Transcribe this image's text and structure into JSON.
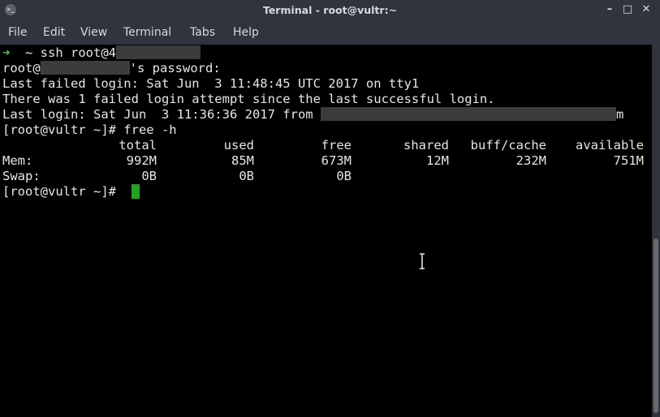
{
  "window": {
    "title": "Terminal - root@vultr:~",
    "app_icon_glyph": ">_",
    "minimize_glyph": "–",
    "maximize_glyph": "□",
    "close_glyph": "✕"
  },
  "menu": {
    "items": [
      "File",
      "Edit",
      "View",
      "Terminal",
      "Tabs",
      "Help"
    ]
  },
  "terminal": {
    "line1_arrow": "➜",
    "line1_text": "  ~ ssh root@4",
    "line2_prefix": "root@",
    "line2_suffix": "'s password:",
    "line3": "Last failed login: Sat Jun  3 11:48:45 UTC 2017 on tty1",
    "line4": "There was 1 failed login attempt since the last successful login.",
    "line5_prefix": "Last login: Sat Jun  3 11:36:36 2017 from ",
    "line5_tail": "m",
    "line6": "[root@vultr ~]# free -h",
    "free_headers": [
      "total",
      "used",
      "free",
      "shared",
      "buff/cache",
      "available"
    ],
    "free_rows": [
      {
        "label": "Mem:",
        "values": [
          "992M",
          "85M",
          "673M",
          "12M",
          "232M",
          "751M"
        ]
      },
      {
        "label": "Swap:",
        "values": [
          "0B",
          "0B",
          "0B",
          "",
          "",
          ""
        ]
      }
    ],
    "prompt": "[root@vultr ~]# "
  },
  "colors": {
    "accent": "#4ec94e",
    "cursor": "#1ea51e",
    "chrome": "#2f343f"
  }
}
